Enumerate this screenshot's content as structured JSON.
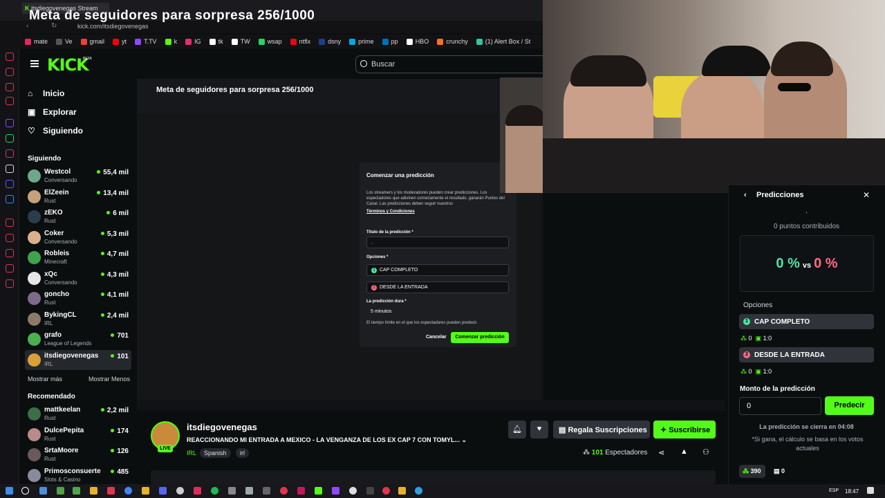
{
  "browser": {
    "tab_label": "itsdiegovenegas Stream",
    "url": "kick.com/itsdiegovenegas",
    "bookmarks": [
      {
        "label": "mate",
        "color": "#e02a5a"
      },
      {
        "label": "Ve",
        "color": "#555555"
      },
      {
        "label": "gmail",
        "color": "#ea4335"
      },
      {
        "label": "yt",
        "color": "#ff0000"
      },
      {
        "label": "T.TV",
        "color": "#9146ff"
      },
      {
        "label": "k",
        "color": "#53fc18"
      },
      {
        "label": "IG",
        "color": "#e1306c"
      },
      {
        "label": "tk",
        "color": "#ffffff"
      },
      {
        "label": "TW",
        "color": "#ffffff"
      },
      {
        "label": "wsap",
        "color": "#25d366"
      },
      {
        "label": "ntflx",
        "color": "#e50914"
      },
      {
        "label": "dsny",
        "color": "#1a3f8f"
      },
      {
        "label": "prime",
        "color": "#00a8e1"
      },
      {
        "label": "pp",
        "color": "#0070ba"
      },
      {
        "label": "HBO",
        "color": "#ffffff"
      },
      {
        "label": "crunchy",
        "color": "#f47521"
      },
      {
        "label": "(1) Alert Box / St",
        "color": "#31c3a2"
      }
    ]
  },
  "overlay_title": "Meta de seguidores para sorpresa 256/1000",
  "header": {
    "logo": "KICK",
    "logo_badge": "BETA",
    "search_placeholder": "Buscar"
  },
  "nav": {
    "home": "Inicio",
    "explore": "Explorar",
    "following": "Siguiendo"
  },
  "following": {
    "heading": "Siguiendo",
    "channels": [
      {
        "name": "Westcol",
        "category": "Conversando",
        "viewers": "55,4 mil",
        "color": "#6ea88a"
      },
      {
        "name": "ElZeein",
        "category": "Rust",
        "viewers": "13,4 mil",
        "color": "#c6a27a"
      },
      {
        "name": "zEKO",
        "category": "Rust",
        "viewers": "6 mil",
        "color": "#2b3c4a"
      },
      {
        "name": "Coker",
        "category": "Conversando",
        "viewers": "5,3 mil",
        "color": "#d9b08c"
      },
      {
        "name": "Robleis",
        "category": "Minecraft",
        "viewers": "4,7 mil",
        "color": "#3fa34d"
      },
      {
        "name": "xQc",
        "category": "Conversando",
        "viewers": "4,3 mil",
        "color": "#e6e6e6"
      },
      {
        "name": "goncho",
        "category": "Rust",
        "viewers": "4,1 mil",
        "color": "#7d6a8a"
      },
      {
        "name": "BykingCL",
        "category": "IRL",
        "viewers": "2,4 mil",
        "color": "#8a7a6a"
      },
      {
        "name": "grafo",
        "category": "League of Legends",
        "viewers": "701",
        "color": "#4caf50"
      },
      {
        "name": "itsdiegovenegas",
        "category": "IRL",
        "viewers": "101",
        "color": "#d9a13a",
        "active": true
      }
    ],
    "show_more": "Mostrar más",
    "show_less": "Mostrar Menos"
  },
  "recommended": {
    "heading": "Recomendado",
    "channels": [
      {
        "name": "mattkeelan",
        "category": "Rust",
        "viewers": "2,2 mil",
        "color": "#3c6e47"
      },
      {
        "name": "DulcePepita",
        "category": "Rust",
        "viewers": "174",
        "color": "#b88a8a"
      },
      {
        "name": "SrtaMoore",
        "category": "Rust",
        "viewers": "126",
        "color": "#6b5a5a"
      },
      {
        "name": "Primosconsuerte",
        "category": "Slots & Casino",
        "viewers": "485",
        "color": "#8a8a9a"
      }
    ]
  },
  "nested_modal": {
    "title": "Comenzar una predicción",
    "description": "Los streamers y los moderadores pueden crear predicciones. Los espectadores que adivinen correctamente el resultado, ganarán Puntos del Canal. Las predicciones deben seguir nuestros",
    "terms": "Términos y Condiciones",
    "title_label": "Título de la predicción *",
    "title_value": ".",
    "options_label": "Opciones *",
    "option1": "CAP COMPLETO",
    "option2": "DESDE LA ENTRADA",
    "duration_label": "La predicción dura *",
    "duration_value": "5 minutos",
    "duration_help": "El tiempo límite en el que los espectadores pueden predecir.",
    "cancel": "Cancelar",
    "start": "Comenzar predicción"
  },
  "prediction": {
    "heading": "Predicciones",
    "title": ".",
    "contributed": "0 puntos contribuidos",
    "pct_left": "0 %",
    "vs": "vs",
    "pct_right": "0 %",
    "options_label": "Opciones",
    "option1": {
      "num": "1",
      "label": "CAP COMPLETO",
      "points": "0",
      "ratio": "1:0"
    },
    "option2": {
      "num": "2",
      "label": "DESDE LA ENTRADA",
      "points": "0",
      "ratio": "1:0"
    },
    "amount_label": "Monto de la predicción",
    "amount_value": "0",
    "predict_button": "Predecir",
    "closes": "La predicción se cierra en 04:08",
    "note": "*Si gana, el cálculo se basa en los votos actuales",
    "user_points": "390",
    "gifts": "0",
    "colors": {
      "green": "#4ce6a4",
      "pink": "#ff6b81",
      "accent": "#53fc18"
    }
  },
  "stream_info": {
    "channel": "itsdiegovenegas",
    "live": "LIVE",
    "title": "REACCIONANDO MI ENTRADA A MEXICO - LA VENGANZA DE LOS EX CAP 7 CON TOMYL...",
    "category": "IRL",
    "tags": [
      "Spanish",
      "irl"
    ],
    "gift_button": "Regala Suscripciones",
    "subscribe_button": "Suscribirse",
    "viewers": "101",
    "viewers_label": "Espectadores"
  },
  "taskbar": {
    "lang": "ESP",
    "time": "18:47"
  }
}
